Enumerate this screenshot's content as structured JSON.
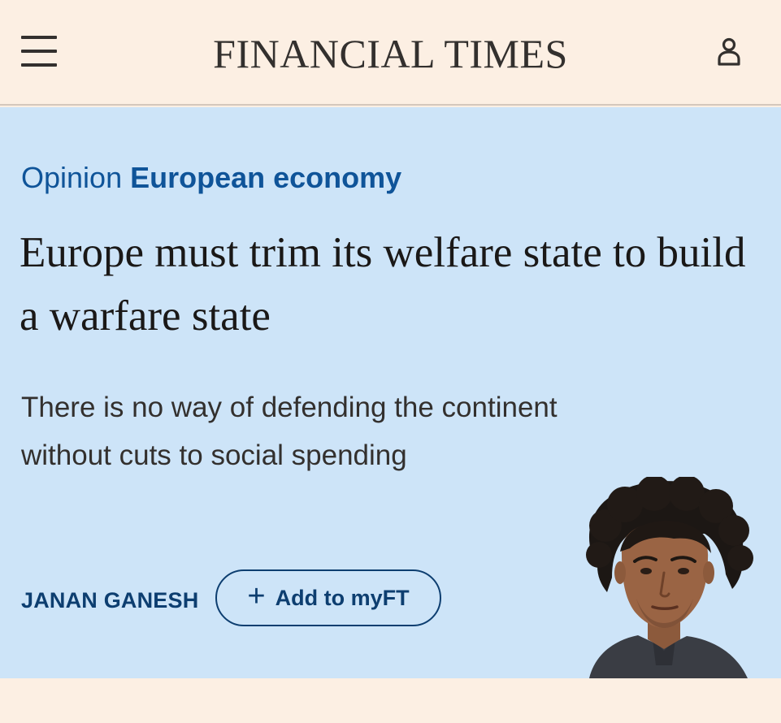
{
  "header": {
    "masthead": "FINANCIAL TIMES",
    "menu_icon": "hamburger-menu-icon",
    "account_icon": "user-account-icon"
  },
  "article": {
    "genre": "Opinion",
    "topic": "European economy",
    "headline": "Europe must trim its welfare state to build a warfare state",
    "standfirst": "There is no way of defending the continent without cuts to social spending",
    "author": "JANAN GANESH",
    "add_to_myft": "Add to myFT"
  },
  "colors": {
    "page_background": "#fcefe3",
    "hero_background": "#cde4f8",
    "link_blue": "#0f5499",
    "byline_blue": "#0d3e70",
    "text": "#1a1817"
  }
}
